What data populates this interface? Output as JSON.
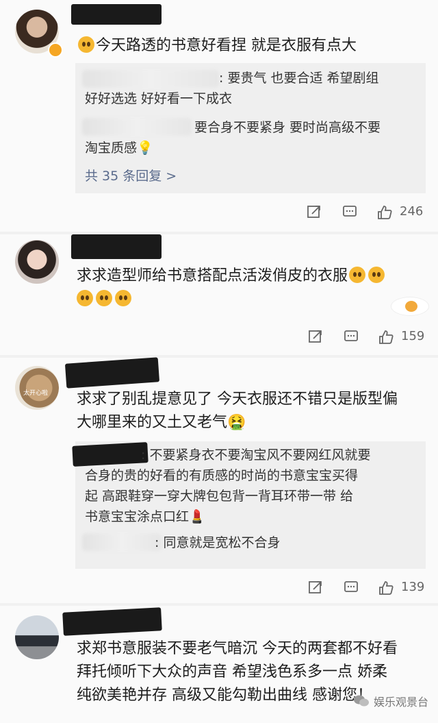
{
  "comments": [
    {
      "text": "今天路透的书意好看捏 就是衣服有点大",
      "replies": [
        {
          "text_l1": ": 要贵气 也要合适 希望剧组",
          "text_l2": "好好选选  好好看一下成衣"
        },
        {
          "text_l1": "要合身不要紧身 要时尚高级不要",
          "text_l2": "淘宝质感"
        }
      ],
      "more_replies": "共 35 条回复 >",
      "likes": "246"
    },
    {
      "text_l1": "求求造型师给书意搭配点活泼俏皮的衣服",
      "likes": "159"
    },
    {
      "avatar_caption": "太开心啦",
      "text_l1": "求求了别乱提意见了 今天衣服还不错只是版型偏",
      "text_l2": "大哪里来的又土又老气",
      "reply_l1": ": 不要紧身衣不要淘宝风不要网红风就要",
      "reply_l2": "合身的贵的好看的有质感的时尚的书意宝宝买得",
      "reply_l3": "起  高跟鞋穿一穿大牌包包背一背耳环带一带 给",
      "reply_l4": "书意宝宝涂点口红",
      "reply2": ": 同意就是宽松不合身",
      "likes": "139"
    },
    {
      "text_l1": "求郑书意服装不要老气暗沉 今天的两套都不好看",
      "text_l2": "拜托倾听下大众的声音   希望浅色系多一点  娇柔",
      "text_l3": "纯欲美艳并存 高级又能勾勒出曲线  感谢您！"
    }
  ],
  "watermark": "娱乐观景台",
  "colors": {
    "accent_link": "#5a6b8c",
    "badge": "#f5a623"
  }
}
